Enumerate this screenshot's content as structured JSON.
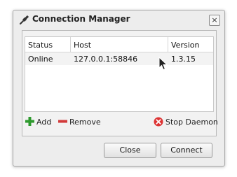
{
  "window": {
    "title": "Connection Manager",
    "close_glyph": "×",
    "app_icon": "plug-icon"
  },
  "table": {
    "headers": [
      "Status",
      "Host",
      "Version"
    ],
    "rows": [
      {
        "status": "Online",
        "host": "127.0.0.1:58846",
        "version": "1.3.15"
      }
    ]
  },
  "toolbar": {
    "add_label": "Add",
    "remove_label": "Remove",
    "stop_label": "Stop Daemon"
  },
  "buttons": {
    "close_label": "Close",
    "connect_label": "Connect"
  }
}
